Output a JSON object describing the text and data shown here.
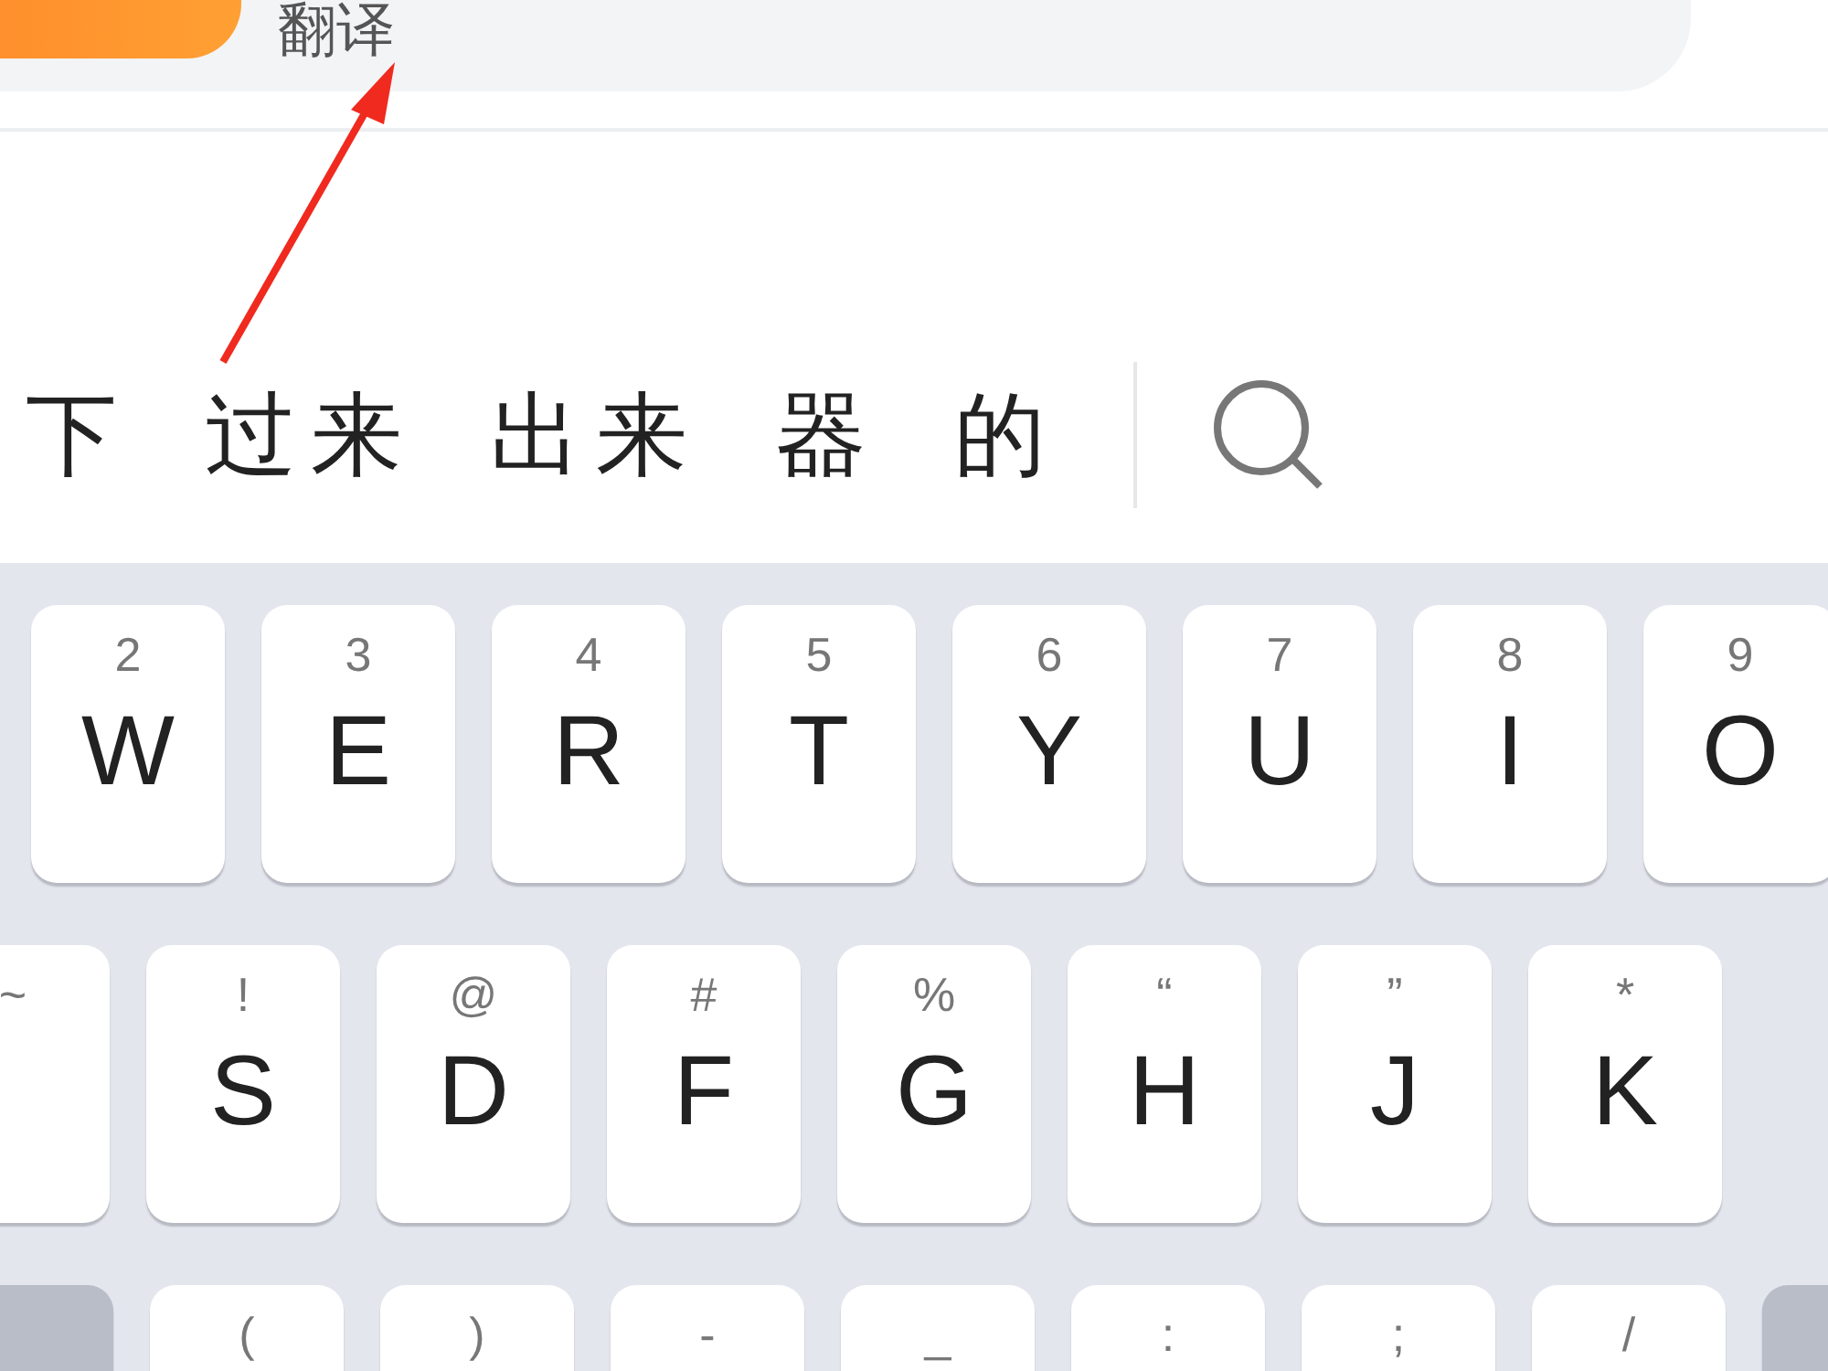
{
  "search_bar": {
    "value": "翻译"
  },
  "candidates": [
    "下",
    "过来",
    "出来",
    "器",
    "的"
  ],
  "keyboard": {
    "rows": [
      {
        "keys": [
          {
            "kind": "letter",
            "hint": "2",
            "label": "W"
          },
          {
            "kind": "letter",
            "hint": "3",
            "label": "E"
          },
          {
            "kind": "letter",
            "hint": "4",
            "label": "R"
          },
          {
            "kind": "letter",
            "hint": "5",
            "label": "T"
          },
          {
            "kind": "letter",
            "hint": "6",
            "label": "Y"
          },
          {
            "kind": "letter",
            "hint": "7",
            "label": "U"
          },
          {
            "kind": "letter",
            "hint": "8",
            "label": "I"
          },
          {
            "kind": "letter",
            "hint": "9",
            "label": "O"
          }
        ]
      },
      {
        "keys": [
          {
            "kind": "letter",
            "hint": "~"
          },
          {
            "kind": "letter",
            "hint": "!",
            "label": "S"
          },
          {
            "kind": "letter",
            "hint": "@",
            "label": "D"
          },
          {
            "kind": "letter",
            "hint": "#",
            "label": "F"
          },
          {
            "kind": "letter",
            "hint": "%",
            "label": "G"
          },
          {
            "kind": "letter",
            "hint": "“",
            "label": "H"
          },
          {
            "kind": "letter",
            "hint": "”",
            "label": "J"
          },
          {
            "kind": "letter",
            "hint": "*",
            "label": "K"
          }
        ]
      },
      {
        "keys": [
          {
            "kind": "function"
          },
          {
            "kind": "letter",
            "hint": "("
          },
          {
            "kind": "letter",
            "hint": ")"
          },
          {
            "kind": "letter",
            "hint": "-"
          },
          {
            "kind": "letter",
            "hint": "_"
          },
          {
            "kind": "letter",
            "hint": ":"
          },
          {
            "kind": "letter",
            "hint": ";"
          },
          {
            "kind": "letter",
            "hint": "/"
          },
          {
            "kind": "function"
          }
        ]
      }
    ]
  }
}
